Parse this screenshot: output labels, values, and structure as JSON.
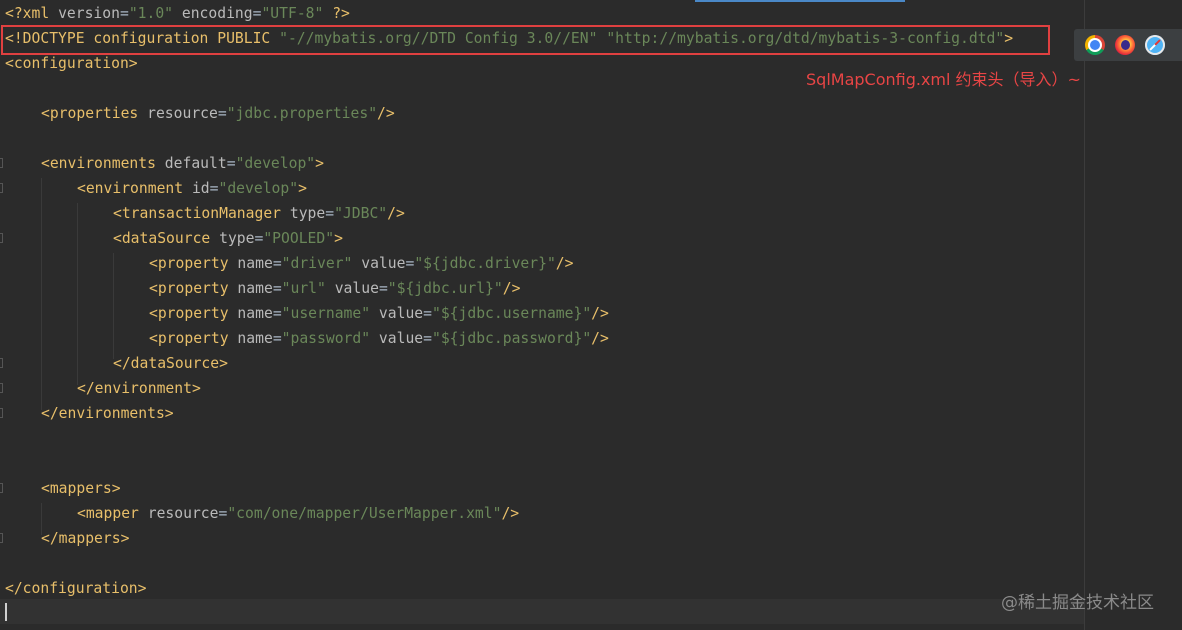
{
  "editor": {
    "lines": {
      "xml_decl": {
        "open": "<?xml ",
        "attr1": "version",
        "eq1": "=",
        "val1": "\"1.0\"",
        "attr2": " encoding",
        "eq2": "=",
        "val2": "\"UTF-8\"",
        "close": " ?>"
      },
      "doctype": {
        "prefix": "<!DOCTYPE configuration PUBLIC ",
        "val1": "\"-//mybatis.org//DTD Config 3.0//EN\"",
        "space": " ",
        "val2": "\"http://mybatis.org/dtd/mybatis-3-config.dtd\"",
        "close": ">"
      },
      "configuration_open": "<configuration>",
      "properties": {
        "tag": "<properties",
        "attr": " resource",
        "eq": "=",
        "val": "\"jdbc.properties\"",
        "close": "/>"
      },
      "environments_open": {
        "tag": "<environments",
        "attr": " default",
        "eq": "=",
        "val": "\"develop\"",
        "close": ">"
      },
      "environment_open": {
        "tag": "<environment",
        "attr": " id",
        "eq": "=",
        "val": "\"develop\"",
        "close": ">"
      },
      "transaction_manager": {
        "tag": "<transactionManager",
        "attr": " type",
        "eq": "=",
        "val": "\"JDBC\"",
        "close": "/>"
      },
      "data_source_open": {
        "tag": "<dataSource",
        "attr": " type",
        "eq": "=",
        "val": "\"POOLED\"",
        "close": ">"
      },
      "properties_list": [
        {
          "tag": "<property",
          "attr1": " name",
          "eq": "=",
          "val1": "\"driver\"",
          "attr2": " value",
          "val2": "\"${jdbc.driver}\"",
          "close": "/>"
        },
        {
          "tag": "<property",
          "attr1": " name",
          "eq": "=",
          "val1": "\"url\"",
          "attr2": " value",
          "val2": "\"${jdbc.url}\"",
          "close": "/>"
        },
        {
          "tag": "<property",
          "attr1": " name",
          "eq": "=",
          "val1": "\"username\"",
          "attr2": " value",
          "val2": "\"${jdbc.username}\"",
          "close": "/>"
        },
        {
          "tag": "<property",
          "attr1": " name",
          "eq": "=",
          "val1": "\"password\"",
          "attr2": " value",
          "val2": "\"${jdbc.password}\"",
          "close": "/>"
        }
      ],
      "data_source_close": "</dataSource>",
      "environment_close": "</environment>",
      "environments_close": "</environments>",
      "mappers_open": "<mappers>",
      "mapper": {
        "tag": "<mapper",
        "attr": " resource",
        "eq": "=",
        "val": "\"com/one/mapper/UserMapper.xml\"",
        "close": "/>"
      },
      "mappers_close": "</mappers>",
      "configuration_close": "</configuration>"
    }
  },
  "annotation": {
    "text": "SqlMapConfig.xml 约束头（导入）~",
    "color": "#e84545"
  },
  "browser_icons": [
    "chrome-icon",
    "firefox-icon",
    "safari-icon"
  ],
  "watermark": "@稀土掘金技术社区",
  "colors": {
    "background": "#2b2b2b",
    "tag": "#e8bf6a",
    "attribute": "#bababa",
    "string": "#6a8759",
    "highlight_border": "#e04040"
  }
}
